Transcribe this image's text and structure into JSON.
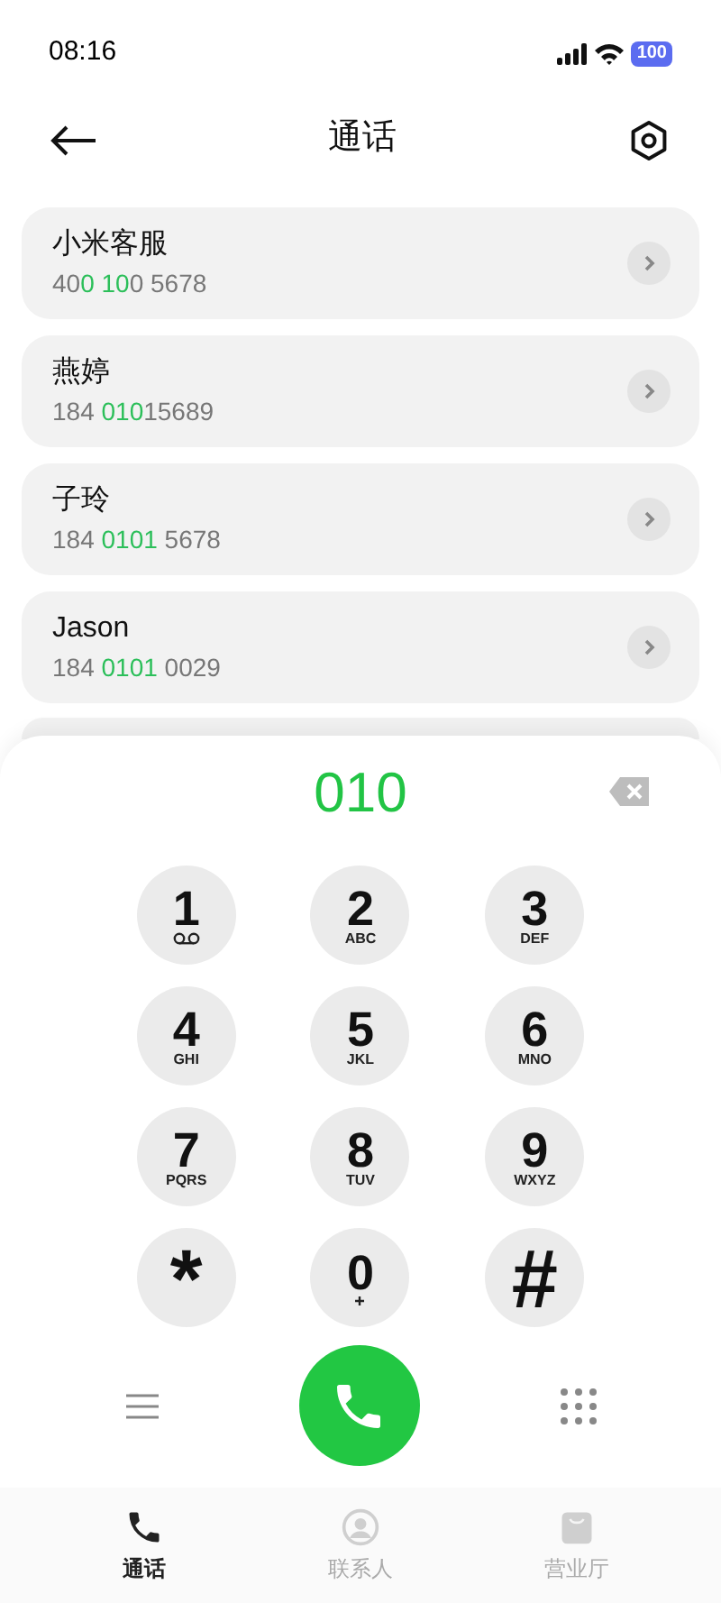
{
  "status_bar": {
    "time": "08:16",
    "battery": "100"
  },
  "header": {
    "title": "通话"
  },
  "contacts": [
    {
      "name": "小米客服",
      "number": [
        {
          "text": "40",
          "match": false
        },
        {
          "text": "0 10",
          "match": true
        },
        {
          "text": "0 5678",
          "match": false
        }
      ]
    },
    {
      "name": "燕婷",
      "number": [
        {
          "text": "184 ",
          "match": false
        },
        {
          "text": "010",
          "match": true
        },
        {
          "text": "15689",
          "match": false
        }
      ]
    },
    {
      "name": "子玲",
      "number": [
        {
          "text": "184 ",
          "match": false
        },
        {
          "text": "0101",
          "match": true
        },
        {
          "text": " 5678",
          "match": false
        }
      ]
    },
    {
      "name": "Jason",
      "number": [
        {
          "text": "184 ",
          "match": false
        },
        {
          "text": "0101",
          "match": true
        },
        {
          "text": " 0029",
          "match": false
        }
      ]
    }
  ],
  "dialer": {
    "entered": "010",
    "keys": [
      {
        "kind": "voicemail",
        "digit": "1"
      },
      {
        "kind": "letters",
        "digit": "2",
        "letters": "ABC"
      },
      {
        "kind": "letters",
        "digit": "3",
        "letters": "DEF"
      },
      {
        "kind": "letters",
        "digit": "4",
        "letters": "GHI"
      },
      {
        "kind": "letters",
        "digit": "5",
        "letters": "JKL"
      },
      {
        "kind": "letters",
        "digit": "6",
        "letters": "MNO"
      },
      {
        "kind": "letters",
        "digit": "7",
        "letters": "PQRS"
      },
      {
        "kind": "letters",
        "digit": "8",
        "letters": "TUV"
      },
      {
        "kind": "letters",
        "digit": "9",
        "letters": "WXYZ"
      },
      {
        "kind": "plain",
        "digit": "*"
      },
      {
        "kind": "plus",
        "digit": "0"
      },
      {
        "kind": "plain",
        "digit": "#"
      }
    ]
  },
  "bottom_nav": [
    {
      "label": "通话",
      "selected": true
    },
    {
      "label": "联系人",
      "selected": false
    },
    {
      "label": "营业厅",
      "selected": false
    }
  ]
}
